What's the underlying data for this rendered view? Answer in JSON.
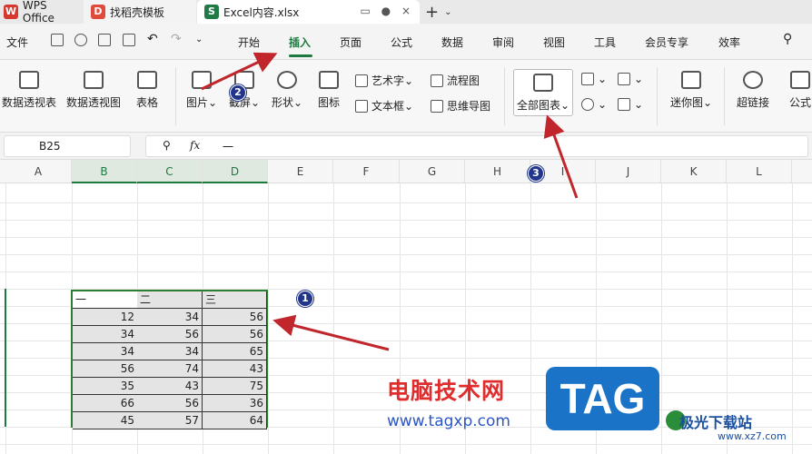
{
  "tabs": {
    "wps": "WPS Office",
    "find": "找稻壳模板",
    "file": "Excel内容.xlsx",
    "wps_icon": "W",
    "find_icon": "D",
    "file_icon": "S"
  },
  "menu": {
    "file": "文件",
    "start": "开始",
    "insert": "插入",
    "page": "页面",
    "formula": "公式",
    "data": "数据",
    "review": "审阅",
    "view": "视图",
    "tools": "工具",
    "member": "会员专享",
    "efficiency": "效率"
  },
  "ribbon": {
    "pivot_table": "数据透视表",
    "pivot_chart": "数据透视图",
    "table": "表格",
    "picture": "图片",
    "screenshot": "截屏",
    "shape": "形状",
    "icon": "图标",
    "art_text": "艺术字",
    "text_box": "文本框",
    "flowchart": "流程图",
    "mindmap": "思维导图",
    "all_charts": "全部图表",
    "sparkline": "迷你图",
    "hyperlink": "超链接",
    "formula_cut": "公式"
  },
  "formula_bar": {
    "name_box": "B25",
    "fx": "fx",
    "content": "一"
  },
  "columns": [
    "A",
    "B",
    "C",
    "D",
    "E",
    "F",
    "G",
    "H",
    "I",
    "J",
    "K",
    "L"
  ],
  "sheet": {
    "headers": [
      "一",
      "二",
      "三"
    ],
    "rows": [
      [
        "12",
        "34",
        "56"
      ],
      [
        "34",
        "56",
        "56"
      ],
      [
        "34",
        "34",
        "65"
      ],
      [
        "56",
        "74",
        "43"
      ],
      [
        "35",
        "43",
        "75"
      ],
      [
        "66",
        "56",
        "36"
      ],
      [
        "45",
        "57",
        "64"
      ]
    ]
  },
  "annotations": {
    "badge1": "1",
    "badge2": "2",
    "badge3": "3",
    "color": "#c0262c"
  },
  "watermark": {
    "cn": "电脑技术网",
    "url": "www.tagxp.com",
    "tag": "TAG",
    "jg": "极光下载站",
    "jg_url": "www.xz7.com"
  },
  "colors": {
    "accent": "#1c7a3e",
    "badge": "#21368a"
  }
}
